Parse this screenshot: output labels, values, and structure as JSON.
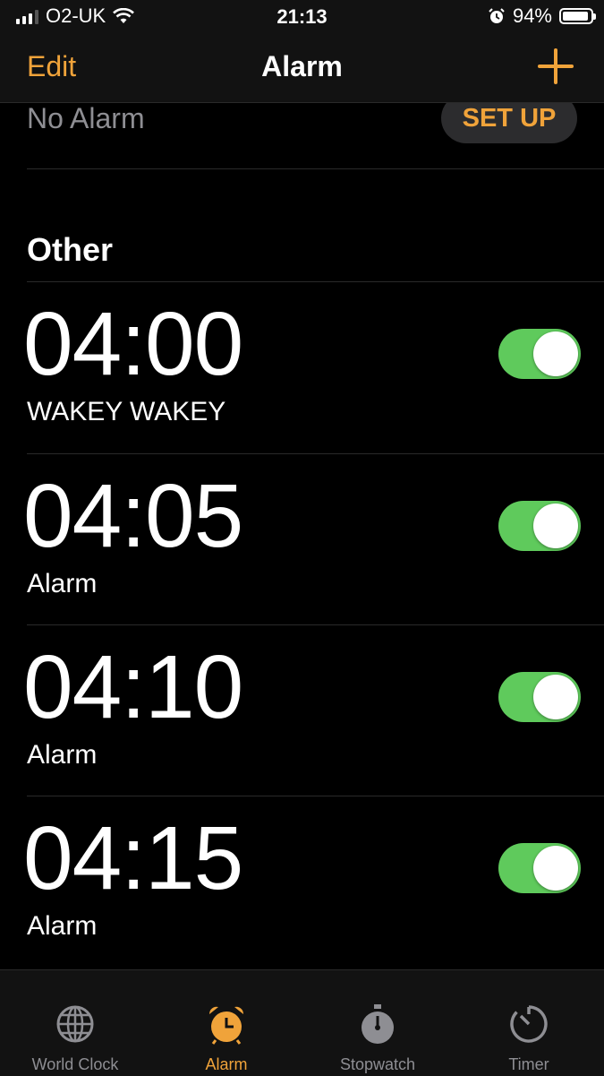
{
  "status_bar": {
    "carrier": "O2-UK",
    "time": "21:13",
    "battery_percent": "94%",
    "battery_level": 0.94
  },
  "nav": {
    "edit_label": "Edit",
    "title": "Alarm",
    "add_icon": "plus-icon"
  },
  "sleep": {
    "no_alarm_text": "No Alarm",
    "setup_label": "SET UP"
  },
  "section": {
    "title": "Other"
  },
  "alarms": [
    {
      "time": "04:00",
      "label": "WAKEY WAKEY",
      "enabled": true
    },
    {
      "time": "04:05",
      "label": "Alarm",
      "enabled": true
    },
    {
      "time": "04:10",
      "label": "Alarm",
      "enabled": true
    },
    {
      "time": "04:15",
      "label": "Alarm",
      "enabled": true
    }
  ],
  "tabs": [
    {
      "label": "World Clock",
      "icon": "globe-icon",
      "active": false
    },
    {
      "label": "Alarm",
      "icon": "alarm-clock-icon",
      "active": true
    },
    {
      "label": "Stopwatch",
      "icon": "stopwatch-icon",
      "active": false
    },
    {
      "label": "Timer",
      "icon": "timer-icon",
      "active": false
    }
  ],
  "colors": {
    "accent": "#f0a33a",
    "toggle_on": "#5fca5c",
    "background": "#000000",
    "bar": "#121212"
  }
}
